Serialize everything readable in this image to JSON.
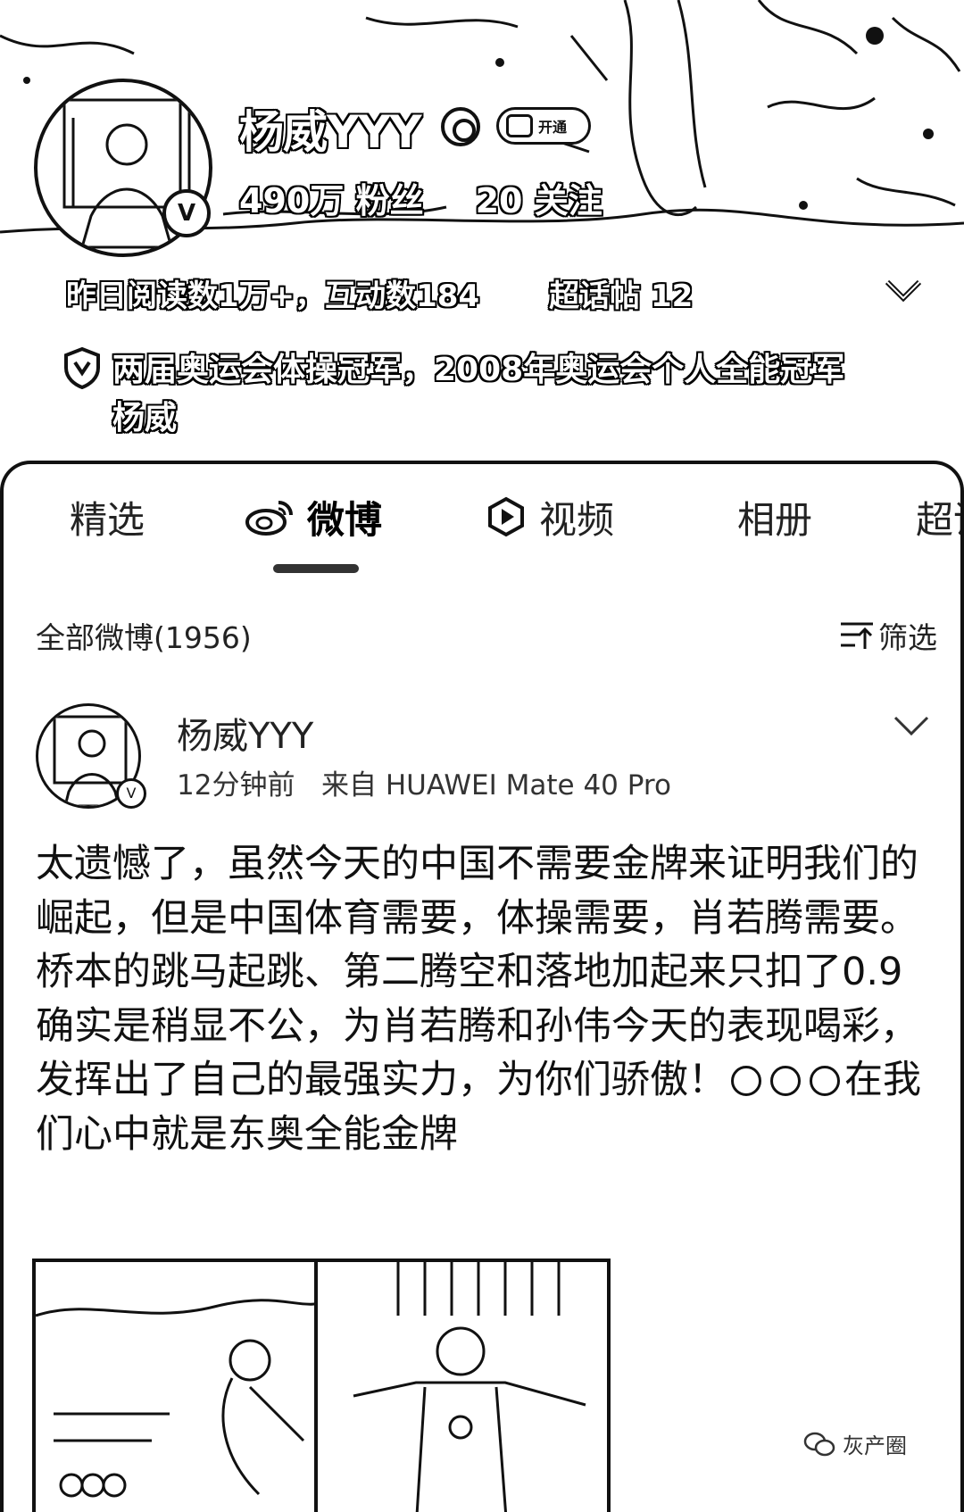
{
  "profile": {
    "name": "杨威YYY",
    "vip_label": "开通",
    "followers_count": "490万",
    "followers_label": "粉丝",
    "following_count": "20",
    "following_label": "关注",
    "activity": "昨日阅读数1万+，互动数184",
    "supertopic": "超话帖 12",
    "bio": "两届奥运会体操冠军，2008年奥运会个人全能冠军杨威"
  },
  "tabs": [
    {
      "label": "精选",
      "icon": null
    },
    {
      "label": "微博",
      "icon": "weibo-icon",
      "active": true
    },
    {
      "label": "视频",
      "icon": "video-icon"
    },
    {
      "label": "相册",
      "icon": null
    },
    {
      "label": "超话",
      "icon": null
    }
  ],
  "feed": {
    "count_label": "全部微博(1956)",
    "filter_label": "筛选"
  },
  "post": {
    "author": "杨威YYY",
    "time": "12分钟前",
    "source": "来自 HUAWEI Mate 40 Pro",
    "text_before": "太遗憾了，虽然今天的中国不需要金牌来证明我们的崛起，但是中国体育需要，体操需要，肖若腾需要。桥本的跳马起跳、第二腾空和落地加起来只扣了0.9确实是稍显不公，为肖若腾和孙伟今天的表现喝彩，发挥出了自己的最强实力，为你们骄傲！",
    "emoji_count": 3,
    "text_after": "在我们心中就是东奥全能金牌"
  },
  "watermark": "灰产圈"
}
